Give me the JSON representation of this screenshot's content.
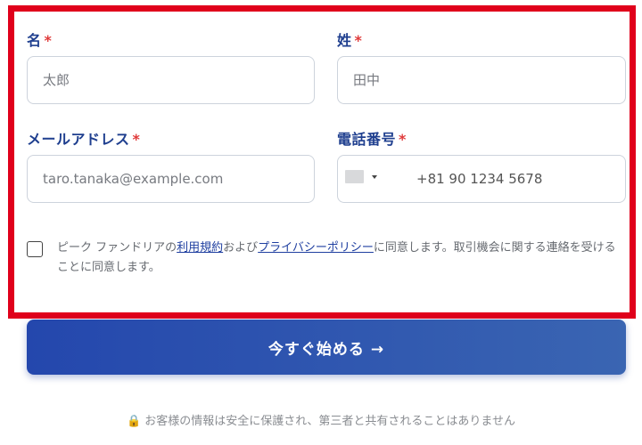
{
  "form": {
    "first_name": {
      "label": "名",
      "required_mark": "*",
      "placeholder": "太郎"
    },
    "last_name": {
      "label": "姓",
      "required_mark": "*",
      "placeholder": "田中"
    },
    "email": {
      "label": "メールアドレス",
      "required_mark": "*",
      "placeholder": "taro.tanaka@example.com"
    },
    "phone": {
      "label": "電話番号",
      "required_mark": "*",
      "placeholder": "+81 90 1234 5678"
    },
    "consent": {
      "text_before": "ピーク ファンドリアの",
      "terms_link": "利用規約",
      "text_middle": "および",
      "privacy_link": "プライバシーポリシー",
      "text_after": "に同意します。取引機会に関する連絡を受けることに同意します。",
      "checked": false
    }
  },
  "submit": {
    "label": "今すぐ始める →"
  },
  "privacy_note": {
    "icon": "lock-icon",
    "text": "お客様の情報は安全に保護され、第三者と共有されることはありません"
  },
  "colors": {
    "accent": "#2447ad",
    "label": "#1f3f8f",
    "required": "#e03a3a",
    "highlight_frame": "#e0001b"
  }
}
